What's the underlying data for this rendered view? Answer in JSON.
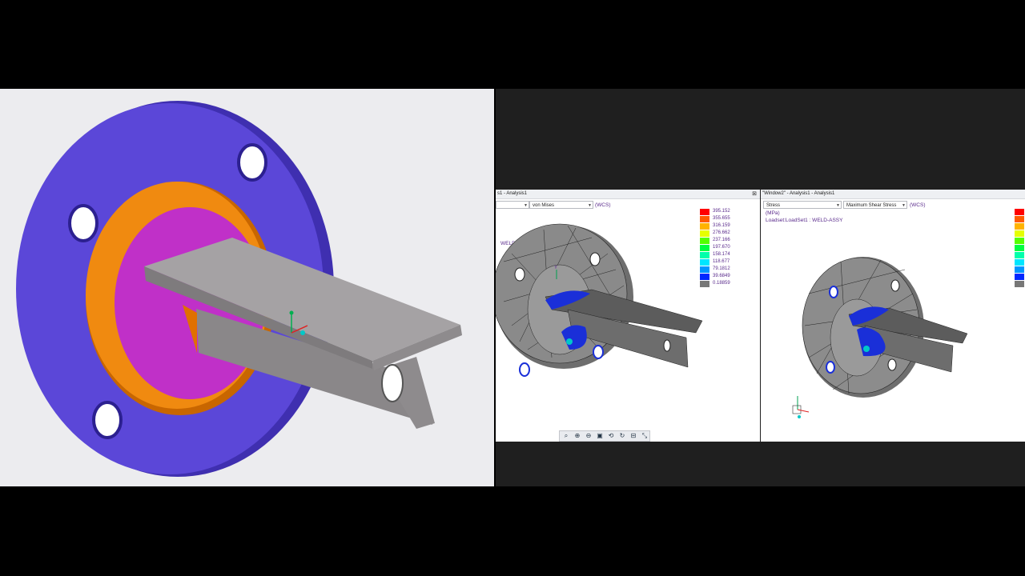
{
  "window1": {
    "title": "s1 - Analysis1",
    "close_glyph": "⊠",
    "combo_left": "",
    "combo_right": "von Mises",
    "wcs": "(WCS)",
    "label_weld": "WELD-ASSY"
  },
  "window2": {
    "title": "\"Window2\" - Analysis1 - Analysis1",
    "combo_left": "Stress",
    "combo_right": "Maximum Shear Stress",
    "wcs": "(WCS)",
    "units": "(MPa)",
    "loadset": "Loadset:LoadSet1 :  WELD-ASSY"
  },
  "legend": {
    "values": [
      "395.152",
      "355.655",
      "316.159",
      "276.662",
      "237.166",
      "197.670",
      "158.174",
      "118.677",
      "79.1812",
      "39.6849",
      "0.18859"
    ],
    "colors": [
      "#ff0000",
      "#ff5a00",
      "#ffb300",
      "#e5ff00",
      "#55ff00",
      "#00ff40",
      "#00ffaa",
      "#00e6ff",
      "#0096ff",
      "#0028ff",
      "#777777"
    ]
  },
  "toolbar": {
    "icons": [
      "zoom-icon",
      "zoom-in-icon",
      "zoom-out-icon",
      "fit-icon",
      "refit-icon",
      "spin-icon",
      "cut-icon",
      "measure-icon"
    ]
  },
  "colors": {
    "flange": "#5b47d8",
    "weld_ring": "#f08000",
    "hub": "#c030c8",
    "tbar": "#9a9698",
    "mesh_gray": "#7a7a7a",
    "stress_blue": "#1a2fd8"
  }
}
